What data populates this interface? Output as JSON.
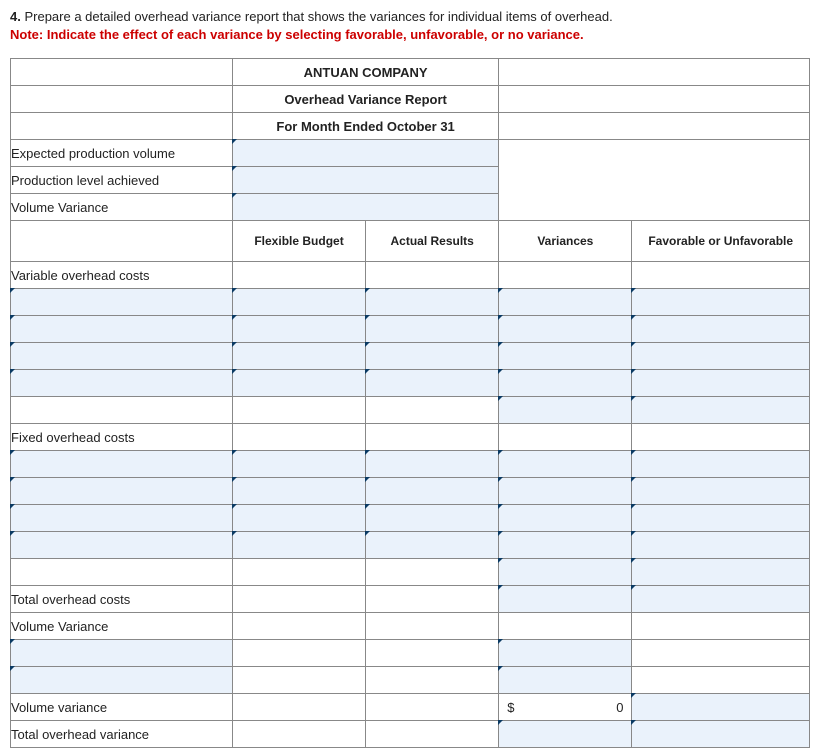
{
  "question": {
    "number": "4.",
    "text": "Prepare a detailed overhead variance report that shows the variances for individual items of overhead.",
    "note": "Note: Indicate the effect of each variance by selecting favorable, unfavorable, or no variance."
  },
  "report": {
    "company": "ANTUAN COMPANY",
    "title": "Overhead Variance Report",
    "period": "For Month Ended October 31",
    "top_rows": {
      "r1": "Expected production volume",
      "r2": "Production level achieved",
      "r3": "Volume Variance"
    },
    "columns": {
      "c1": "Flexible Budget",
      "c2": "Actual Results",
      "c3": "Variances",
      "c4": "Favorable or Unfavorable"
    },
    "sections": {
      "variable": "Variable overhead costs",
      "fixed": "Fixed overhead costs",
      "total_oh": "Total overhead costs",
      "vol_var_section": "Volume Variance",
      "vol_var": "Volume variance",
      "total_var": "Total overhead variance"
    },
    "values": {
      "vol_var_currency": "$",
      "vol_var_amount": "0"
    }
  }
}
